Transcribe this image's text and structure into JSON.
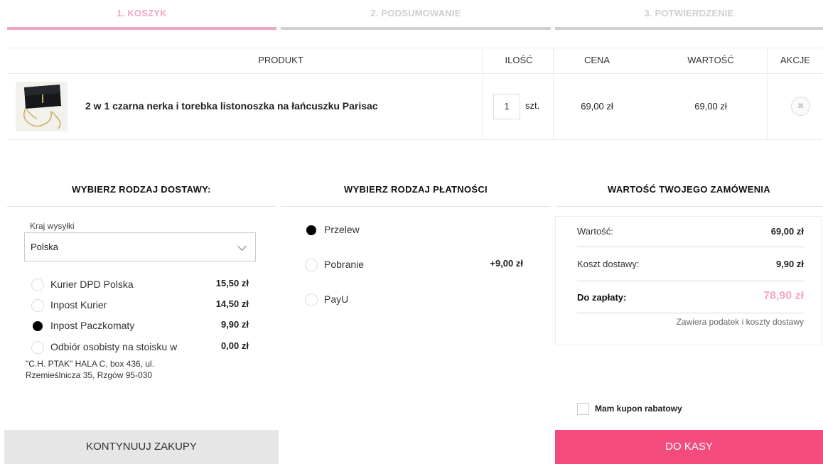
{
  "steps": [
    {
      "label": "1. KOSZYK",
      "active": true
    },
    {
      "label": "2. PODSUMOWANIE",
      "active": false
    },
    {
      "label": "3. POTWIERDZENIE",
      "active": false
    }
  ],
  "cart": {
    "headers": {
      "product": "PRODUKT",
      "qty": "ILOŚĆ",
      "price": "CENA",
      "value": "WARTOŚĆ",
      "actions": "AKCJE"
    },
    "items": [
      {
        "name": "2 w 1 czarna nerka i torebka listonoszka na łańcuszku Parisac",
        "qty": "1",
        "unit": "szt.",
        "price": "69,00 zł",
        "value": "69,00 zł",
        "remove_icon": "close-icon"
      }
    ]
  },
  "delivery": {
    "heading": "WYBIERZ RODZAJ DOSTAWY:",
    "country_label": "Kraj wysyłki",
    "country_value": "Polska",
    "options": [
      {
        "label": "Kurier DPD Polska",
        "price": "15,50 zł",
        "selected": false
      },
      {
        "label": "Inpost Kurier",
        "price": "14,50 zł",
        "selected": false
      },
      {
        "label": "Inpost Paczkomaty",
        "price": "9,90 zł",
        "selected": true
      },
      {
        "label": "Odbiór osobisty na stoisku w",
        "price": "0,00 zł",
        "selected": false
      }
    ],
    "address": "\"C.H. PTAK\" HALA C, box 436, ul. Rzemieślnicza 35, Rzgów 95-030"
  },
  "payment": {
    "heading": "WYBIERZ RODZAJ PŁATNOŚCI",
    "options": [
      {
        "label": "Przelew",
        "price": "",
        "selected": true
      },
      {
        "label": "Pobranie",
        "price": "+9,00 zł",
        "selected": false
      },
      {
        "label": "PayU",
        "price": "",
        "selected": false
      }
    ]
  },
  "summary": {
    "heading": "WARTOŚĆ TWOJEGO ZAMÓWENIA",
    "value_label": "Wartość:",
    "value": "69,00 zł",
    "shipping_label": "Koszt dostawy:",
    "shipping": "9,90 zł",
    "total_label": "Do zapłaty:",
    "total": "78,90 zł",
    "note": "Zawiera podatek i koszty dostawy",
    "coupon_label": "Mam kupon rabatowy"
  },
  "buttons": {
    "continue": "KONTYNUUJ ZAKUPY",
    "checkout": "DO KASY"
  },
  "colors": {
    "accent_pink": "#f44b7e",
    "step_active": "#f2a7bc",
    "total_pink": "#f7a6bf"
  }
}
